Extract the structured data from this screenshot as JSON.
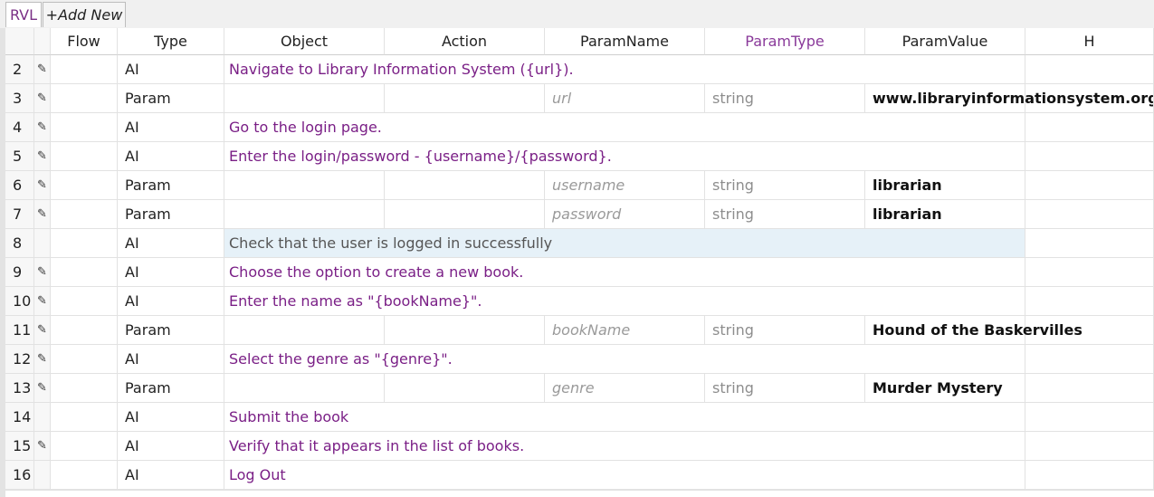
{
  "tabs": {
    "rvl_label": "RVL",
    "add_new_label": "+Add New"
  },
  "columns": [
    "Flow",
    "Type",
    "Object",
    "Action",
    "ParamName",
    "ParamType",
    "ParamValue",
    "H"
  ],
  "rows": [
    {
      "num": "2",
      "edit": "✎",
      "type": "AI",
      "text": "Navigate to Library Information System ({url})."
    },
    {
      "num": "3",
      "edit": "✎",
      "type": "Param",
      "param_name": "url",
      "param_type": "string",
      "param_value": "www.libraryinformationsystem.org"
    },
    {
      "num": "4",
      "edit": "✎",
      "type": "AI",
      "text": "Go to the login page."
    },
    {
      "num": "5",
      "edit": "✎",
      "type": "AI",
      "text": "Enter the login/password - {username}/{password}."
    },
    {
      "num": "6",
      "edit": "✎",
      "type": "Param",
      "param_name": "username",
      "param_type": "string",
      "param_value": "librarian"
    },
    {
      "num": "7",
      "edit": "✎",
      "type": "Param",
      "param_name": "password",
      "param_type": "string",
      "param_value": "librarian"
    },
    {
      "num": "8",
      "edit": "",
      "type": "AI",
      "text": "Check that the user is logged in successfully"
    },
    {
      "num": "9",
      "edit": "✎",
      "type": "AI",
      "text": "Choose the option to create a new book."
    },
    {
      "num": "10",
      "edit": "✎",
      "type": "AI",
      "text": "Enter the name as \"{bookName}\"."
    },
    {
      "num": "11",
      "edit": "✎",
      "type": "Param",
      "param_name": "bookName",
      "param_type": "string",
      "param_value": "Hound of the Baskervilles"
    },
    {
      "num": "12",
      "edit": "✎",
      "type": "AI",
      "text": "Select the genre as \"{genre}\"."
    },
    {
      "num": "13",
      "edit": "✎",
      "type": "Param",
      "param_name": "genre",
      "param_type": "string",
      "param_value": "Murder Mystery"
    },
    {
      "num": "14",
      "edit": "",
      "type": "AI",
      "text": "Submit the book"
    },
    {
      "num": "15",
      "edit": "✎",
      "type": "AI",
      "text": "Verify that it appears in the list of books."
    },
    {
      "num": "16",
      "edit": "",
      "type": "AI",
      "text": "Log Out"
    }
  ],
  "selected_row": "8",
  "colors": {
    "accent": "#7a1f86",
    "selection": "#e6f1f8"
  }
}
